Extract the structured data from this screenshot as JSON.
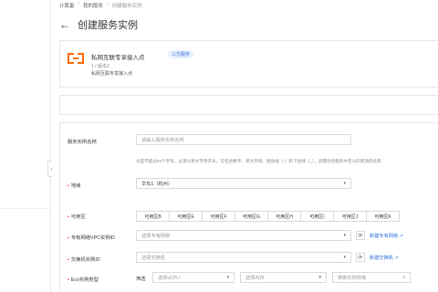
{
  "breadcrumb": {
    "items": [
      "计算巢",
      "我的服务",
      "创建服务实例"
    ]
  },
  "header": {
    "back_glyph": "←",
    "title": "创建服务实例"
  },
  "service": {
    "name": "私网互联专享接入点",
    "badge": "三方服务",
    "version": "1 / 版本2",
    "description": "私网互联专享接入点"
  },
  "form": {
    "instance_name": {
      "label": "服务实例名称",
      "placeholder": "请输入服务实例名称",
      "hint": "长度不超过64个字符，必须以英文字母开头，可包含数字、英文字母、短划线（-）和下划线（_），且需符合服务中定义的资源的名称"
    },
    "region": {
      "label": "地域",
      "value": "华东1（杭州）"
    },
    "zones": {
      "label": "可用区",
      "options": [
        "可用区B",
        "可用区E",
        "可用区F",
        "可用区G",
        "可用区H",
        "可用区I",
        "可用区J",
        "可用区K"
      ]
    },
    "vpc": {
      "label": "专有网络VPC实例ID",
      "placeholder": "选择专有网络",
      "create_link": "新建专有网络"
    },
    "vswitch": {
      "label": "交换机实例ID",
      "placeholder": "选择交换机",
      "create_link": "新建交换机"
    },
    "ecs": {
      "label": "Ecs实例类型",
      "filter_label": "筛选",
      "vcpu_placeholder": "选择vCPU",
      "memory_placeholder": "选择内存",
      "search_placeholder": "搜索实例规格"
    }
  },
  "icons": {
    "refresh": "refresh-icon",
    "external": "external-link-icon",
    "search": "search-icon"
  },
  "colors": {
    "brand": "#ff6a00",
    "link": "#2f6fe0",
    "required": "#e02b2b"
  }
}
